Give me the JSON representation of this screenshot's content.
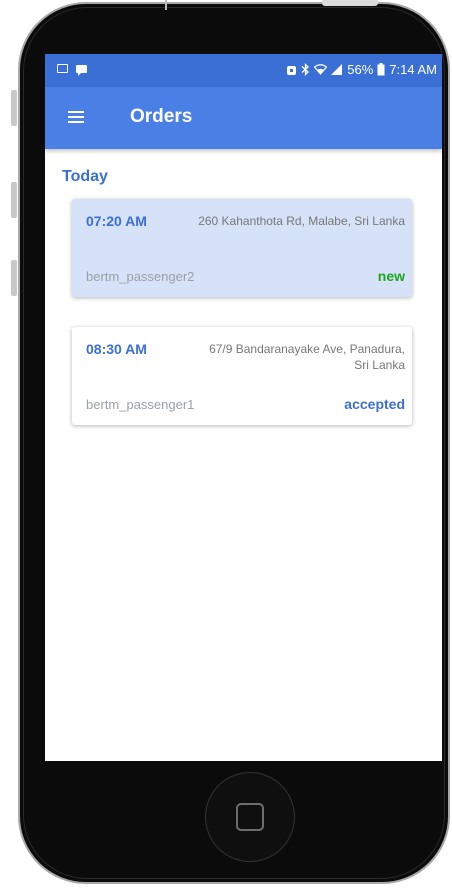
{
  "status_bar": {
    "battery_percent": "56%",
    "time": "7:14 AM"
  },
  "app_bar": {
    "title": "Orders"
  },
  "section": {
    "label": "Today"
  },
  "orders": [
    {
      "time": "07:20 AM",
      "address": "260 Kahanthota Rd, Malabe, Sri Lanka",
      "passenger": "bertm_passenger2",
      "status": "new",
      "status_color": "#1fa51f",
      "highlighted": true
    },
    {
      "time": "08:30 AM",
      "address": "67/9 Bandaranayake Ave, Panadura, Sri Lanka",
      "passenger": "bertm_passenger1",
      "status": "accepted",
      "status_color": "#3a6fd6",
      "highlighted": false
    }
  ],
  "colors": {
    "primary": "#4a7fe6",
    "status_bar": "#3a6fd6",
    "accent_blue": "#3a6fd6",
    "status_new": "#1fa51f"
  },
  "icons": [
    "image-icon",
    "message-icon",
    "alarm-icon",
    "bluetooth-icon",
    "wifi-icon",
    "signal-icon",
    "battery-icon",
    "menu-icon",
    "home-button-icon"
  ]
}
